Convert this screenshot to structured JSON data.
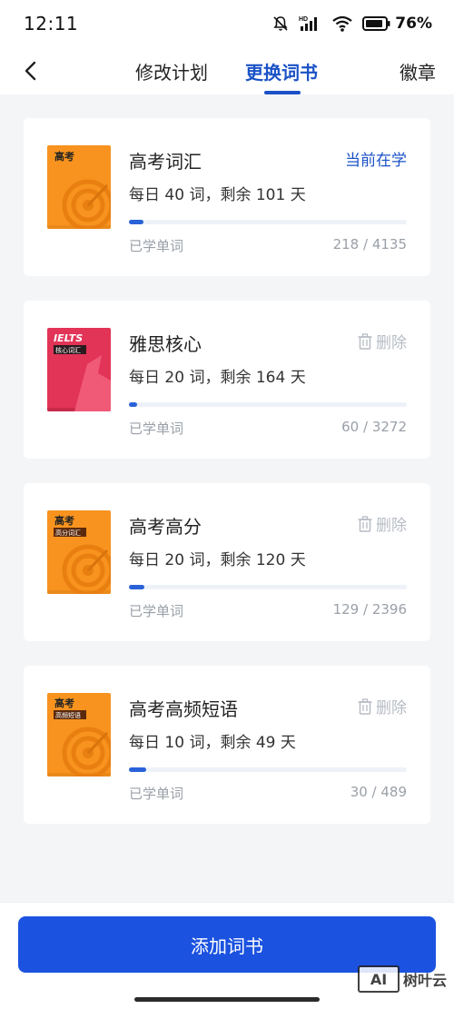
{
  "status_bar": {
    "time": "12:11",
    "battery": "76",
    "hd_label": "HD"
  },
  "nav": {
    "back_icon": "chevron-left-icon",
    "tabs": [
      {
        "label": "修改计划",
        "active": false
      },
      {
        "label": "更换词书",
        "active": true
      },
      {
        "label": "徽章",
        "active": false
      }
    ]
  },
  "books": [
    {
      "title": "高考词汇",
      "plan": "每日 40 词，剩余 101 天",
      "status": "当前在学",
      "learned_label": "已学单词",
      "learned": "218 / 4135",
      "progress": 0.053,
      "cover": {
        "top": "高考",
        "sub": "",
        "color": "#f7931e"
      }
    },
    {
      "title": "雅思核心",
      "plan": "每日 20 词，剩余 164 天",
      "action": "删除",
      "learned_label": "已学单词",
      "learned": "60 / 3272",
      "progress": 0.018,
      "cover": {
        "top": "IELTS",
        "sub": "核心词汇",
        "color": "#e23457"
      }
    },
    {
      "title": "高考高分",
      "plan": "每日 20 词，剩余 120 天",
      "action": "删除",
      "learned_label": "已学单词",
      "learned": "129 / 2396",
      "progress": 0.054,
      "cover": {
        "top": "高考",
        "sub": "高分词汇",
        "color": "#f7931e"
      }
    },
    {
      "title": "高考高频短语",
      "plan": "每日 10 词，剩余 49 天",
      "action": "删除",
      "learned_label": "已学单词",
      "learned": "30 / 489",
      "progress": 0.061,
      "cover": {
        "top": "高考",
        "sub": "高频短语",
        "color": "#f7931e"
      }
    }
  ],
  "add_button": "添加词书",
  "watermark": {
    "logo": "AI",
    "text": "树叶云"
  }
}
